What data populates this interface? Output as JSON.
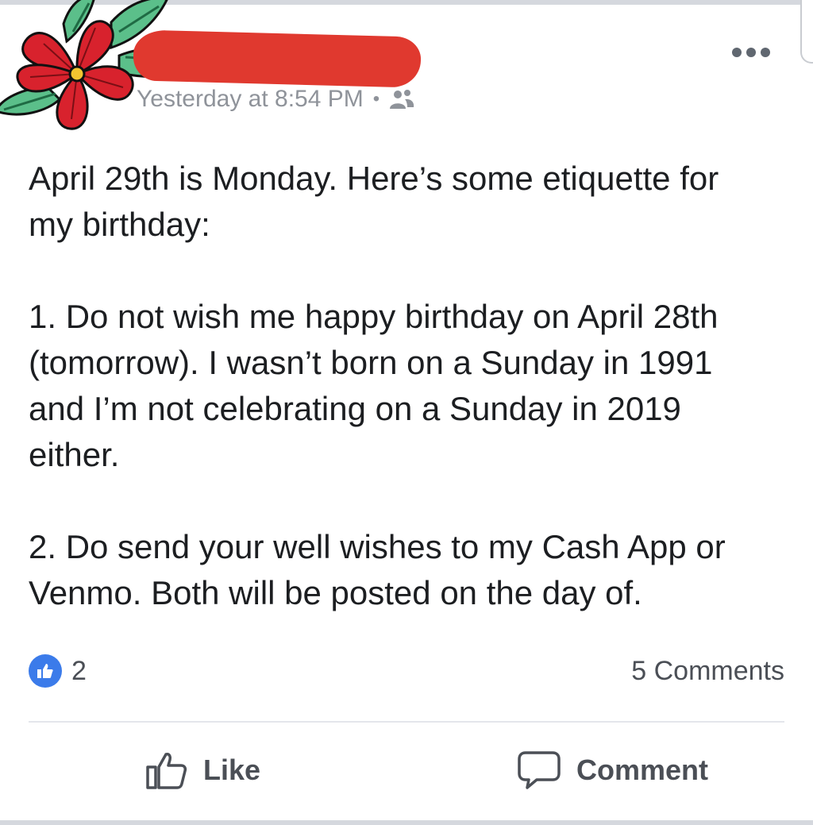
{
  "post": {
    "timestamp": "Yesterday at 8:54 PM",
    "separator": "•",
    "audience_icon": "friends-icon",
    "more_icon": "more-options-icon",
    "text": {
      "intro_line1": "April 29th is Monday. Here’s some etiquette for",
      "intro_line2": "my birthday:",
      "item1_line1": "1. Do not wish me happy birthday on April 28th",
      "item1_line2": "(tomorrow). I wasn’t born on a Sunday in 1991",
      "item1_line3": "and I’m not celebrating on a Sunday in 2019",
      "item1_line4": "either.",
      "item2_line1": "2. Do send your well wishes to my Cash App or",
      "item2_line2": "Venmo. Both will be posted on the day of."
    }
  },
  "stats": {
    "like_count": "2",
    "comments": "5 Comments"
  },
  "actions": {
    "like_label": "Like",
    "comment_label": "Comment"
  },
  "colors": {
    "like_badge": "#3b7bea",
    "redaction": "#e0392f",
    "flower_red": "#d8222d",
    "leaf_green": "#3aa16a"
  }
}
